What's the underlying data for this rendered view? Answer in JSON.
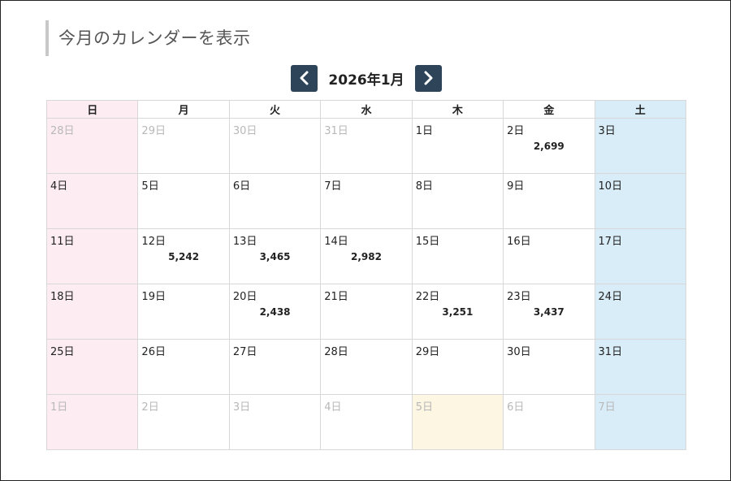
{
  "page_title": "今月のカレンダーを表示",
  "month_label": "2026年1月",
  "weekdays": [
    "日",
    "月",
    "火",
    "水",
    "木",
    "金",
    "土"
  ],
  "weeks": [
    [
      {
        "day": "28日",
        "other": true
      },
      {
        "day": "29日",
        "other": true
      },
      {
        "day": "30日",
        "other": true
      },
      {
        "day": "31日",
        "other": true
      },
      {
        "day": "1日"
      },
      {
        "day": "2日",
        "count": "2,699"
      },
      {
        "day": "3日"
      }
    ],
    [
      {
        "day": "4日"
      },
      {
        "day": "5日"
      },
      {
        "day": "6日"
      },
      {
        "day": "7日"
      },
      {
        "day": "8日"
      },
      {
        "day": "9日"
      },
      {
        "day": "10日"
      }
    ],
    [
      {
        "day": "11日"
      },
      {
        "day": "12日",
        "count": "5,242"
      },
      {
        "day": "13日",
        "count": "3,465"
      },
      {
        "day": "14日",
        "count": "2,982"
      },
      {
        "day": "15日"
      },
      {
        "day": "16日"
      },
      {
        "day": "17日"
      }
    ],
    [
      {
        "day": "18日"
      },
      {
        "day": "19日"
      },
      {
        "day": "20日",
        "count": "2,438"
      },
      {
        "day": "21日"
      },
      {
        "day": "22日",
        "count": "3,251"
      },
      {
        "day": "23日",
        "count": "3,437"
      },
      {
        "day": "24日"
      }
    ],
    [
      {
        "day": "25日"
      },
      {
        "day": "26日"
      },
      {
        "day": "27日"
      },
      {
        "day": "28日"
      },
      {
        "day": "29日"
      },
      {
        "day": "30日"
      },
      {
        "day": "31日"
      }
    ],
    [
      {
        "day": "1日",
        "other": true
      },
      {
        "day": "2日",
        "other": true
      },
      {
        "day": "3日",
        "other": true
      },
      {
        "day": "4日",
        "other": true
      },
      {
        "day": "5日",
        "other": true,
        "today": true
      },
      {
        "day": "6日",
        "other": true
      },
      {
        "day": "7日",
        "other": true
      }
    ]
  ],
  "colors": {
    "sunday_bg": "#fdedf2",
    "saturday_bg": "#d9edf8",
    "today_bg": "#fdf6e3",
    "nav_button_bg": "#2e4459",
    "other_month_text": "#b8b8b8"
  },
  "icons": {
    "prev": "chevron-left-icon",
    "next": "chevron-right-icon"
  }
}
